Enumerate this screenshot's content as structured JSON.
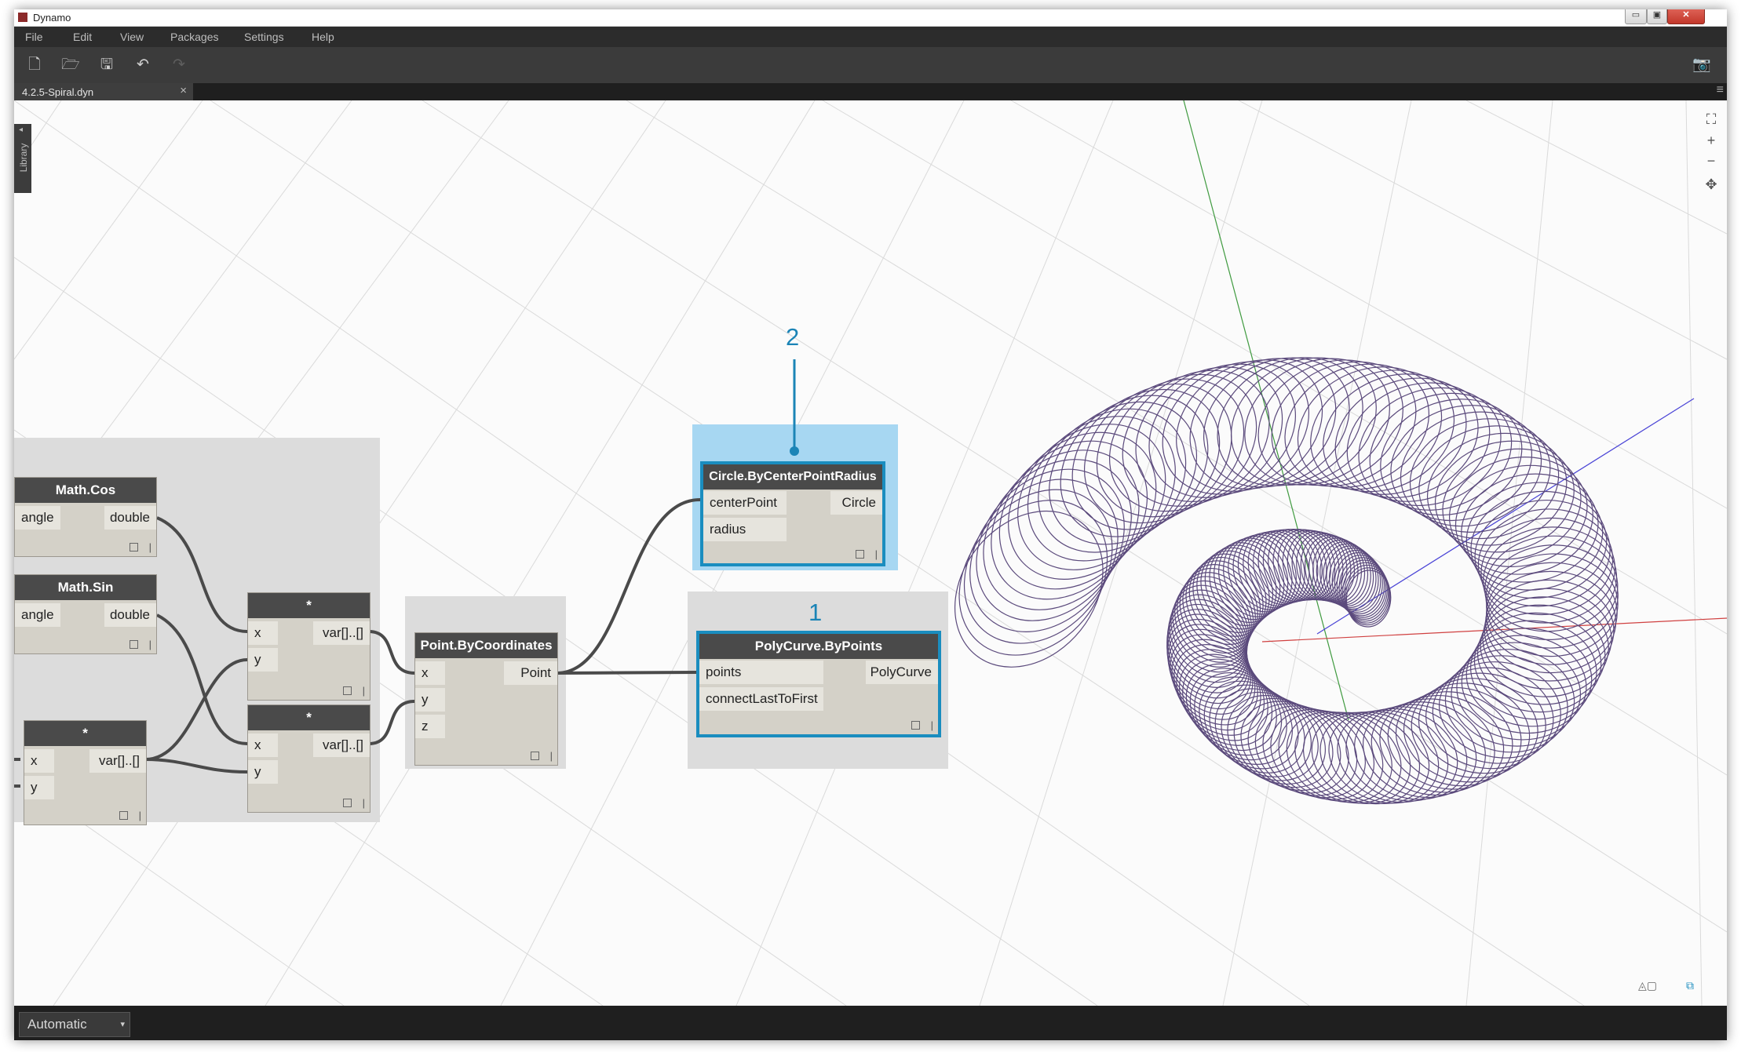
{
  "window": {
    "title": "Dynamo"
  },
  "window_buttons": {
    "minimize": "▭",
    "restore": "▣",
    "close": "✕"
  },
  "menu": [
    "File",
    "Edit",
    "View",
    "Packages",
    "Settings",
    "Help"
  ],
  "toolbar": {
    "new": "🗋",
    "open": "🗁",
    "save": "🖫",
    "undo": "↶",
    "redo": "↷",
    "screenshot": "📷"
  },
  "tab": {
    "label": "4.2.5-Spiral.dyn",
    "close": "×"
  },
  "tab_menu": "≡",
  "library_label": "Library",
  "library_arrow": "◂",
  "nav": {
    "fit": "⛶",
    "zoom_in": "+",
    "zoom_out": "−",
    "pan": "✥"
  },
  "nodes": {
    "math_cos": {
      "title": "Math.Cos",
      "inputs": [
        "angle"
      ],
      "outputs": [
        "double"
      ]
    },
    "math_sin": {
      "title": "Math.Sin",
      "inputs": [
        "angle"
      ],
      "outputs": [
        "double"
      ]
    },
    "mult_top": {
      "title": "*",
      "inputs": [
        "x",
        "y"
      ],
      "outputs": [
        "var[]..[]"
      ]
    },
    "mult_bottom": {
      "title": "*",
      "inputs": [
        "x",
        "y"
      ],
      "outputs": [
        "var[]..[]"
      ]
    },
    "mult_left": {
      "title": "*",
      "inputs": [
        "x",
        "y"
      ],
      "outputs": [
        "var[]..[]"
      ]
    },
    "point_by_coordinates": {
      "title": "Point.ByCoordinates",
      "inputs": [
        "x",
        "y",
        "z"
      ],
      "outputs": [
        "Point"
      ]
    },
    "circle": {
      "title": "Circle.ByCenterPointRadius",
      "inputs": [
        "centerPoint",
        "radius"
      ],
      "outputs": [
        "Circle"
      ]
    },
    "polycurve": {
      "title": "PolyCurve.ByPoints",
      "inputs": [
        "points",
        "connectLastToFirst"
      ],
      "outputs": [
        "PolyCurve"
      ]
    }
  },
  "callouts": {
    "one": "1",
    "two": "2"
  },
  "view_toggle": {
    "geometry": "◬▢",
    "graph": "⧉"
  },
  "status": {
    "run_mode": "Automatic",
    "arrow": "▾"
  },
  "colors": {
    "selection": "#1a8dbf",
    "callout": "#1b84b6",
    "geometry": "#5b4a7c",
    "axis_x": "#d04040",
    "axis_y": "#3f9a3f",
    "axis_z": "#4a44d6"
  }
}
